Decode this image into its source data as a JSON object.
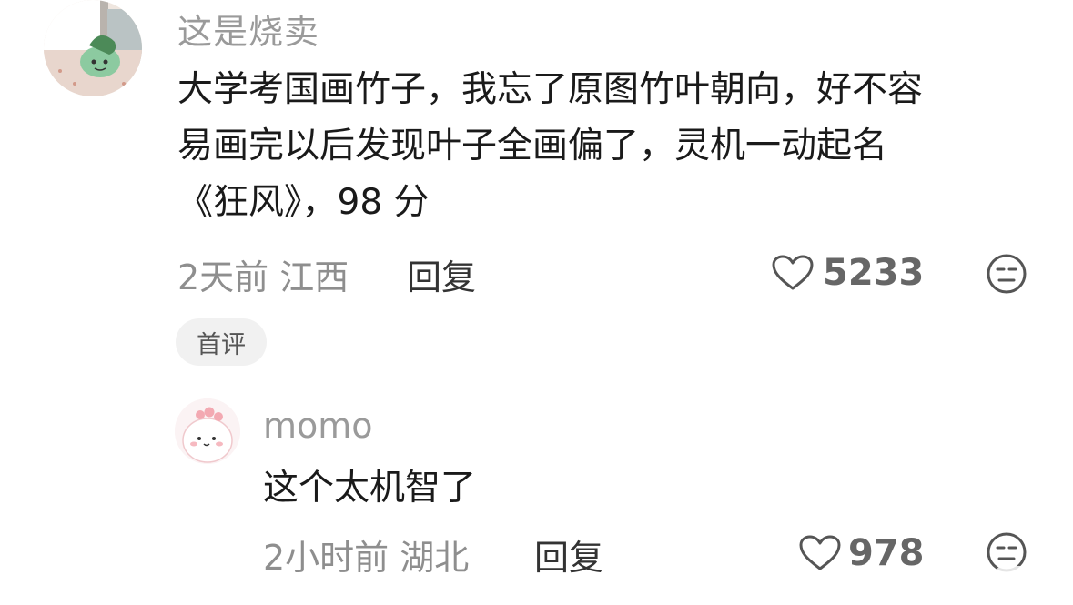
{
  "main_comment": {
    "username": "这是烧卖",
    "lines": [
      "大学考国画竹子，我忘了原图竹叶朝向，好不容",
      "易画完以后发现叶子全画偏了，灵机一动起名",
      "《狂风》，98 分"
    ],
    "meta": "2天前 江西",
    "reply_label": "回复",
    "like_count": "5233",
    "tag": "首评"
  },
  "reply_comment": {
    "username": "momo",
    "text": "这个太机智了",
    "meta": "2小时前 湖北",
    "reply_label": "回复",
    "like_count": "978"
  },
  "colors": {
    "username": "#9a9a9a",
    "text": "#1a1a1a",
    "meta": "#8e8e8e",
    "tag_bg": "#f1f1f1"
  },
  "icons": [
    "heart-outline-icon",
    "neutral-face-icon"
  ]
}
